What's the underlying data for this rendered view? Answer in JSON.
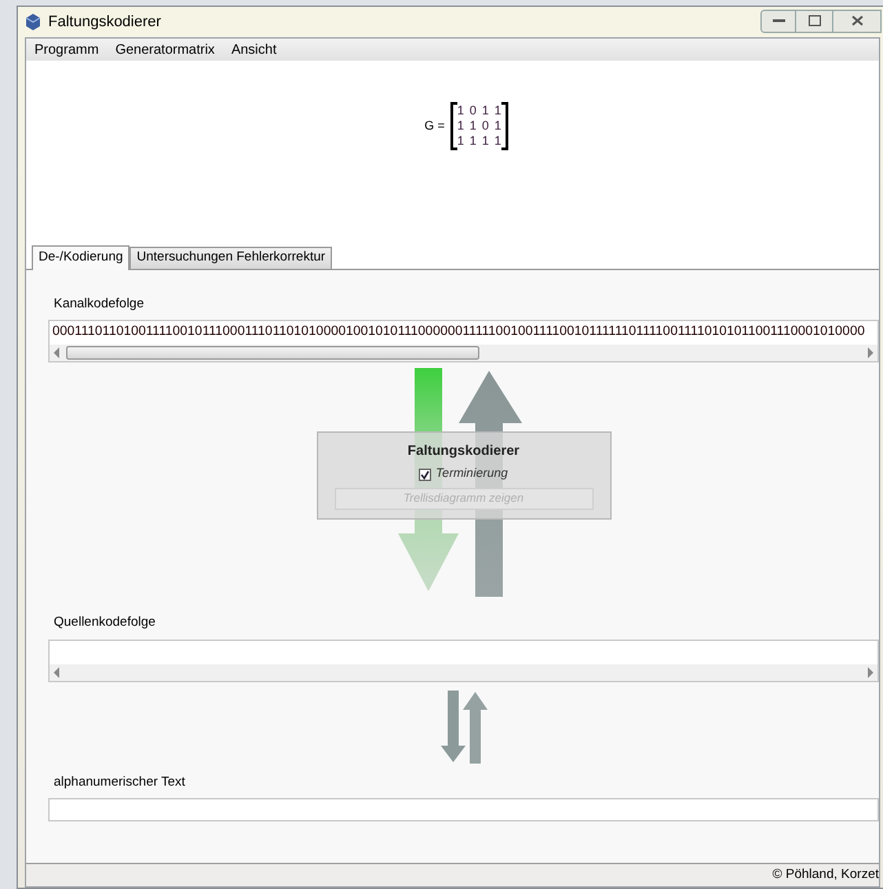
{
  "window": {
    "title": "Faltungskodierer"
  },
  "menu": [
    "Programm",
    "Generatormatrix",
    "Ansicht"
  ],
  "matrix": {
    "label": "G =",
    "rows": [
      [
        "1",
        "0",
        "1",
        "1"
      ],
      [
        "1",
        "1",
        "0",
        "1"
      ],
      [
        "1",
        "1",
        "1",
        "1"
      ]
    ]
  },
  "tabs": [
    {
      "label": "De-/Kodierung",
      "selected": true
    },
    {
      "label": "Untersuchungen Fehlerkorrektur",
      "selected": false
    }
  ],
  "channel": {
    "label": "Kanalkodefolge",
    "value": "000111011010011110010111000111011010100001001010111000000111110010011110010111111011110011110101011001110001010000"
  },
  "coder": {
    "title": "Faltungskodierer",
    "option": {
      "label": "Terminierung",
      "checked": true
    },
    "button": {
      "label": "Trellisdiagramm zeigen",
      "disabled": true
    }
  },
  "source": {
    "label": "Quellenkodefolge"
  },
  "text": {
    "label": "alphanumerischer Text"
  },
  "status_bar": "© Pöhland, Korzet"
}
